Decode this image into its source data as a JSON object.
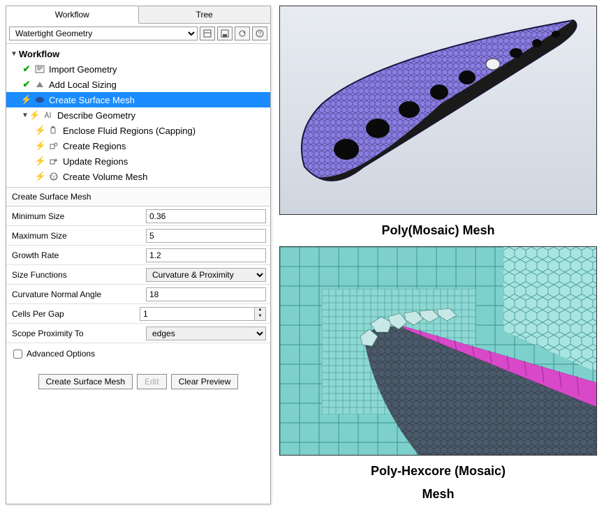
{
  "tabs": {
    "workflow": "Workflow",
    "tree": "Tree"
  },
  "top_select": {
    "value": "Watertight Geometry"
  },
  "icon_buttons": [
    "layout-icon",
    "save-icon",
    "refresh-icon",
    "help-icon"
  ],
  "tree": {
    "root": "Workflow",
    "items": [
      {
        "status": "check",
        "label": "Import Geometry"
      },
      {
        "status": "check",
        "label": "Add Local Sizing"
      },
      {
        "status": "bolt",
        "label": "Create Surface Mesh",
        "selected": true
      },
      {
        "status": "bolt",
        "label": "Describe Geometry",
        "expandable": true,
        "children": [
          {
            "status": "bolt",
            "label": "Enclose Fluid Regions (Capping)"
          },
          {
            "status": "bolt",
            "label": "Create Regions"
          },
          {
            "status": "bolt",
            "label": "Update Regions"
          },
          {
            "status": "bolt",
            "label": "Create Volume Mesh"
          }
        ]
      }
    ]
  },
  "section": {
    "title": "Create Surface Mesh"
  },
  "form": {
    "min_size": {
      "label": "Minimum Size",
      "value": "0.36"
    },
    "max_size": {
      "label": "Maximum Size",
      "value": "5"
    },
    "growth_rate": {
      "label": "Growth Rate",
      "value": "1.2"
    },
    "size_functions": {
      "label": "Size Functions",
      "value": "Curvature & Proximity"
    },
    "curvature_angle": {
      "label": "Curvature Normal Angle",
      "value": "18"
    },
    "cells_per_gap": {
      "label": "Cells Per Gap",
      "value": "1"
    },
    "scope_proximity": {
      "label": "Scope Proximity To",
      "value": "edges"
    },
    "advanced": {
      "label": "Advanced Options",
      "checked": false
    }
  },
  "buttons": {
    "create": "Create Surface Mesh",
    "edit": "Edit",
    "clear": "Clear Preview"
  },
  "captions": {
    "poly_mosaic": "Poly(Mosaic) Mesh",
    "poly_hexcore_1": "Poly-Hexcore (Mosaic)",
    "poly_hexcore_2": "Mesh"
  },
  "colors": {
    "select_bg": "#1a8cff",
    "mesh_purple": "#7c6bd8",
    "mesh_teal": "#63c4c0",
    "mesh_magenta": "#d040c0"
  }
}
